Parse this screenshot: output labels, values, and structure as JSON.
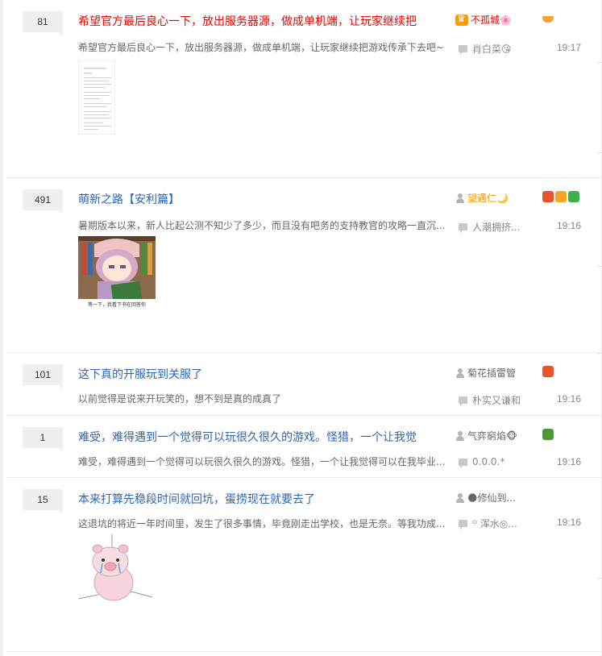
{
  "threads": [
    {
      "reply_count": "81",
      "title": "希望官方最后良心一下，放出服务器源，做成单机端，让玩家继续把",
      "abstract": "希望官方最后良心一下，放出服务器源，做成单机端，让玩家继续把游戏传承下去吧~",
      "author": "不孤城🌸",
      "last_replier": "肖白菜😘",
      "time": "19:17",
      "title_color": "#e10602"
    },
    {
      "reply_count": "491",
      "title": "萌新之路【安利篇】",
      "abstract": "暑期版本以来，新人比起公测不知少了多少，而且没有吧务的支持教官的攻略一直沉...",
      "author": "望遇仁🌙",
      "last_replier": "人潮拥挤...",
      "time": "19:16",
      "image_caption": "等一下，我看下书在回答你"
    },
    {
      "reply_count": "101",
      "title": "这下真的开服玩到关服了",
      "abstract": "以前觉得是说来开玩笑的，想不到是真的成真了",
      "author": "菊花插雷管",
      "last_replier": "朴实又谦和",
      "time": "19:16"
    },
    {
      "reply_count": "1",
      "title": "难受，难得遇到一个觉得可以玩很久很久的游戏。怪猎，一个让我觉",
      "abstract": "难受，难得遇到一个觉得可以玩很久很久的游戏。怪猎，一个让我觉得可以在我毕业...",
      "author": "气弈窮焰🐵",
      "last_replier": "0.0.0.*",
      "time": "19:16"
    },
    {
      "reply_count": "15",
      "title": "本来打算先稳段时间就回坑，蛋捞现在就要去了",
      "abstract": "这退坑的将近一年时间里，发生了很多事情，毕竟刚走出学校，也是无奈。等我功成...",
      "author": "🌑修仙到...",
      "last_replier": "ᴼ 浑水◎...",
      "time": "19:16"
    }
  ]
}
